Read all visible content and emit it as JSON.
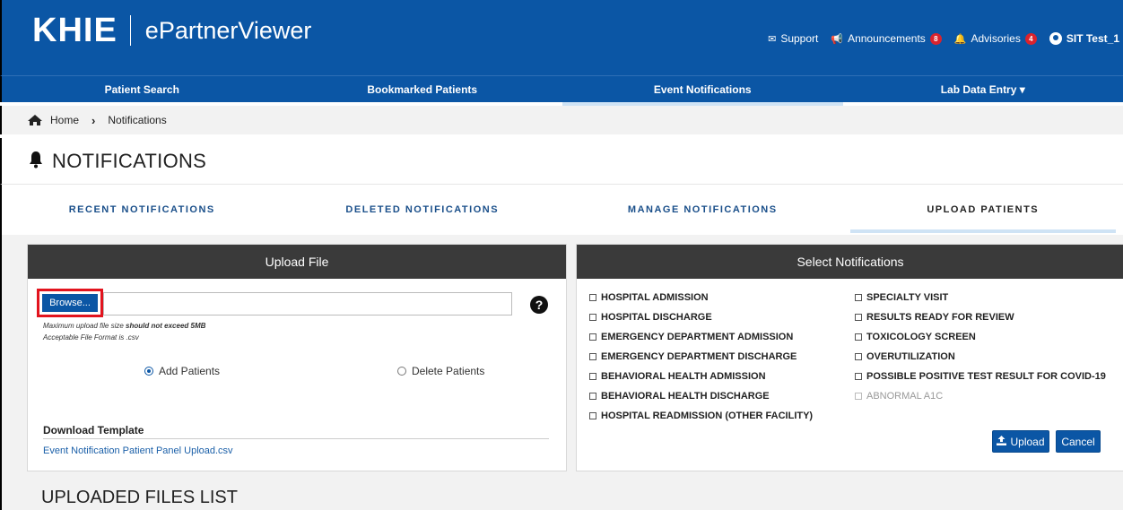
{
  "header": {
    "logo_text": "KHIE",
    "app_name": "ePartnerViewer",
    "links": {
      "support": "Support",
      "announcements": "Announcements",
      "announcements_count": "8",
      "advisories": "Advisories",
      "advisories_count": "4",
      "user": "SIT Test_1"
    }
  },
  "nav": {
    "items": [
      {
        "label": "Patient Search"
      },
      {
        "label": "Bookmarked Patients"
      },
      {
        "label": "Event Notifications"
      },
      {
        "label": "Lab Data Entry ▾"
      }
    ],
    "active_index": 2
  },
  "breadcrumb": {
    "home": "Home",
    "current": "Notifications"
  },
  "page": {
    "title": "NOTIFICATIONS"
  },
  "tabs": [
    {
      "label": "RECENT NOTIFICATIONS"
    },
    {
      "label": "DELETED NOTIFICATIONS"
    },
    {
      "label": "MANAGE NOTIFICATIONS"
    },
    {
      "label": "UPLOAD PATIENTS"
    }
  ],
  "upload_panel": {
    "title": "Upload File",
    "browse_label": "Browse...",
    "help": "?",
    "size_note_prefix": "Maximum upload file size ",
    "size_note_bold": "should not exceed 5MB",
    "format_note": "Acceptable File Format is .csv",
    "add_patients": "Add Patients",
    "delete_patients": "Delete Patients",
    "download_title": "Download Template",
    "download_link": "Event Notification Patient Panel Upload.csv"
  },
  "notifications_panel": {
    "title": "Select Notifications",
    "left_options": [
      "HOSPITAL ADMISSION",
      "HOSPITAL DISCHARGE",
      "EMERGENCY DEPARTMENT ADMISSION",
      "EMERGENCY DEPARTMENT DISCHARGE",
      "BEHAVIORAL HEALTH ADMISSION",
      "BEHAVIORAL HEALTH DISCHARGE",
      "HOSPITAL READMISSION (OTHER FACILITY)"
    ],
    "right_options": [
      "SPECIALTY VISIT",
      "RESULTS READY FOR REVIEW",
      "TOXICOLOGY SCREEN",
      "OVERUTILIZATION",
      "POSSIBLE POSITIVE TEST RESULT FOR COVID-19",
      "ABNORMAL A1C"
    ],
    "upload_label": "Upload",
    "cancel_label": "Cancel"
  },
  "uploaded_files": {
    "title": "UPLOADED FILES LIST"
  },
  "colors": {
    "brand_blue": "#0b56a5",
    "panel_header": "#3a3a3a",
    "badge_red": "#d9232e",
    "highlight_red": "#e2141e"
  }
}
